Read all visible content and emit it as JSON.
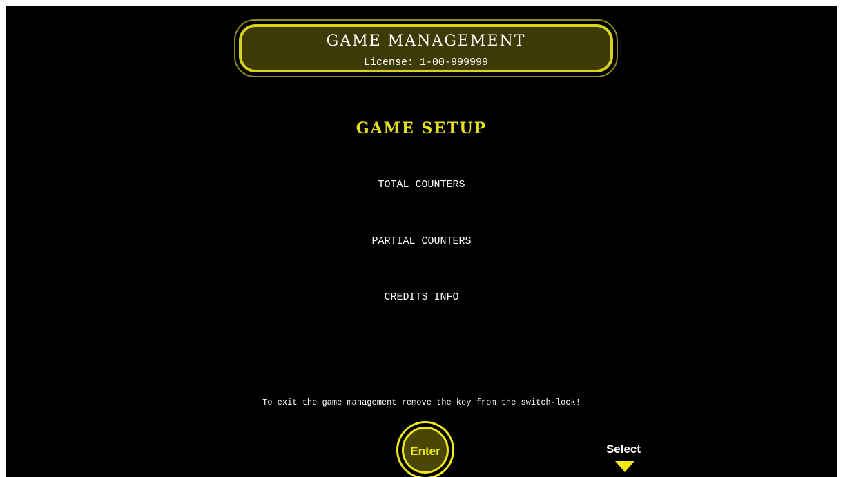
{
  "header": {
    "title": "GAME MANAGEMENT",
    "license": "License: 1-00-999999"
  },
  "section": {
    "title": "GAME SETUP"
  },
  "menu": {
    "items": [
      {
        "label": "TOTAL COUNTERS"
      },
      {
        "label": "PARTIAL COUNTERS"
      },
      {
        "label": "CREDITS INFO"
      }
    ]
  },
  "footer": {
    "exit_message": "To exit the game management remove the key from the switch-lock!",
    "enter_label": "Enter",
    "select_label": "Select"
  },
  "colors": {
    "background": "#000000",
    "accent": "#e6e01a",
    "header_fill": "#3d3a06",
    "text": "#ffffff"
  },
  "icons": {
    "select": "triangle-down-icon"
  }
}
